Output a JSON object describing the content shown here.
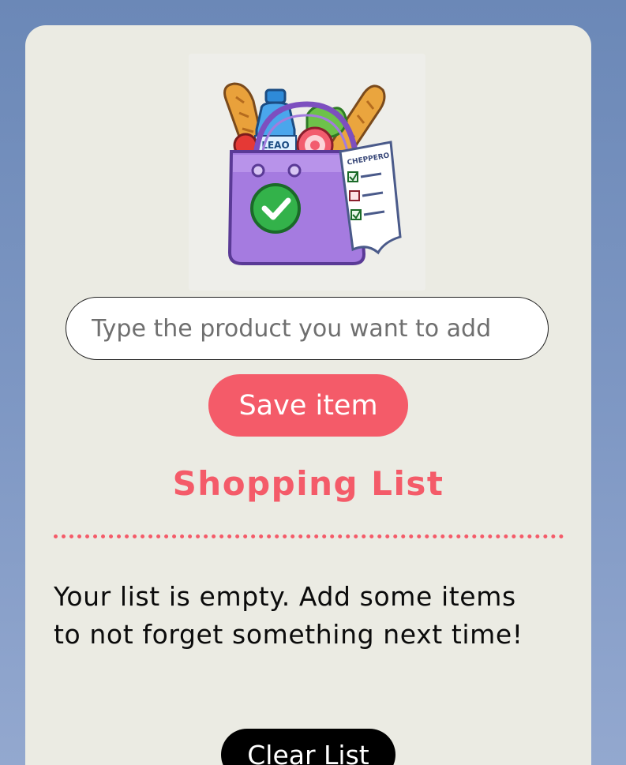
{
  "hero": {
    "icon": "grocery-bag-checklist-icon",
    "bottle_label": "LEAO",
    "receipt_label": "CHEPPERO"
  },
  "form": {
    "input_placeholder": "Type the product you want to add",
    "input_value": "",
    "save_label": "Save item"
  },
  "list": {
    "title": "Shopping List",
    "empty_message": "Your list is empty. Add some items to not forget something next time!",
    "clear_label": "Clear List"
  },
  "colors": {
    "accent": "#f45b69",
    "card_bg": "#ebebe3",
    "page_bg_top": "#6b88b7",
    "page_bg_bottom": "#93a8cf",
    "dark_button": "#000000"
  }
}
